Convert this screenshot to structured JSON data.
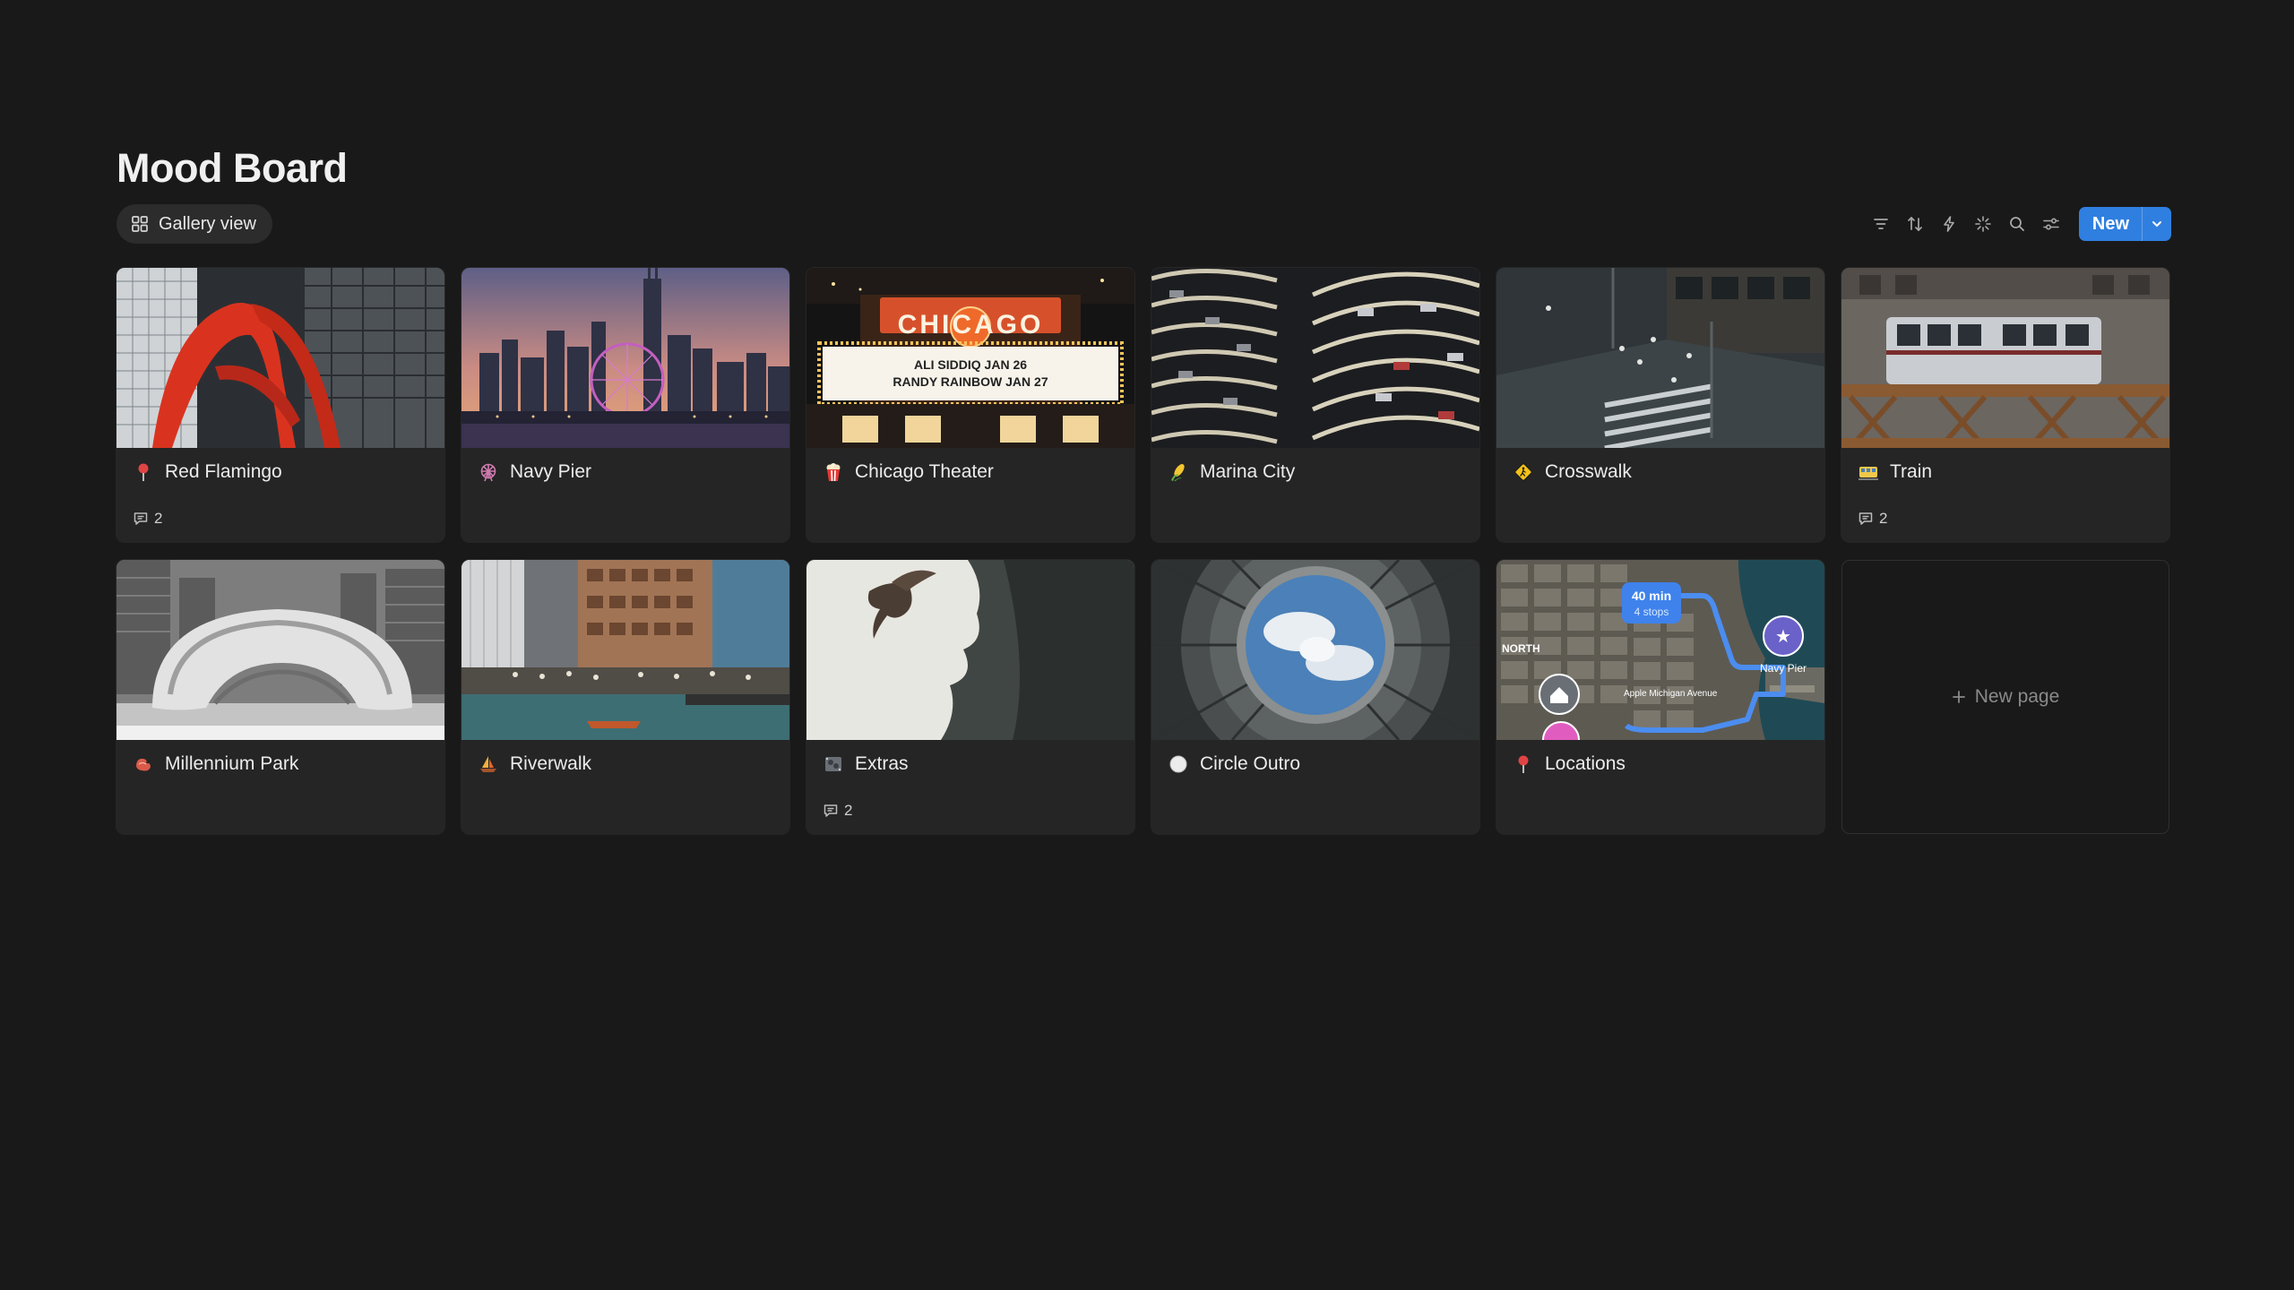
{
  "page": {
    "title": "Mood Board"
  },
  "view": {
    "label": "Gallery view",
    "icon": "gallery-grid-icon"
  },
  "toolbar": {
    "icons": [
      "filter-icon",
      "sort-icon",
      "automation-bolt-icon",
      "ai-sparkle-icon",
      "search-icon",
      "settings-sliders-icon"
    ],
    "new_label": "New",
    "accent": "#2f7fe0"
  },
  "cards": [
    {
      "title": "Red Flamingo",
      "icon": "pin-icon",
      "comments": "2"
    },
    {
      "title": "Navy Pier",
      "icon": "ferris-wheel-icon",
      "comments": ""
    },
    {
      "title": "Chicago Theater",
      "icon": "popcorn-icon",
      "comments": "",
      "marquee": "CHICAGO",
      "marquee_line1": "ALI SIDDIQ JAN 26",
      "marquee_line2": "RANDY RAINBOW JAN 27"
    },
    {
      "title": "Marina City",
      "icon": "corn-icon",
      "comments": ""
    },
    {
      "title": "Crosswalk",
      "icon": "pedestrian-sign-icon",
      "comments": ""
    },
    {
      "title": "Train",
      "icon": "tram-icon",
      "comments": "2"
    },
    {
      "title": "Millennium Park",
      "icon": "bean-icon",
      "comments": ""
    },
    {
      "title": "Riverwalk",
      "icon": "sailboat-icon",
      "comments": ""
    },
    {
      "title": "Extras",
      "icon": "film-frames-icon",
      "comments": "2"
    },
    {
      "title": "Circle Outro",
      "icon": "white-circle-icon",
      "comments": ""
    },
    {
      "title": "Locations",
      "icon": "pin-icon",
      "comments": "",
      "map_time": "40 min",
      "map_stops": "4 stops",
      "map_label_navy": "Navy Pier",
      "map_label_north": "NORTH",
      "map_label_ave": "Apple Michigan Avenue"
    }
  ],
  "new_page": {
    "label": "New page"
  }
}
